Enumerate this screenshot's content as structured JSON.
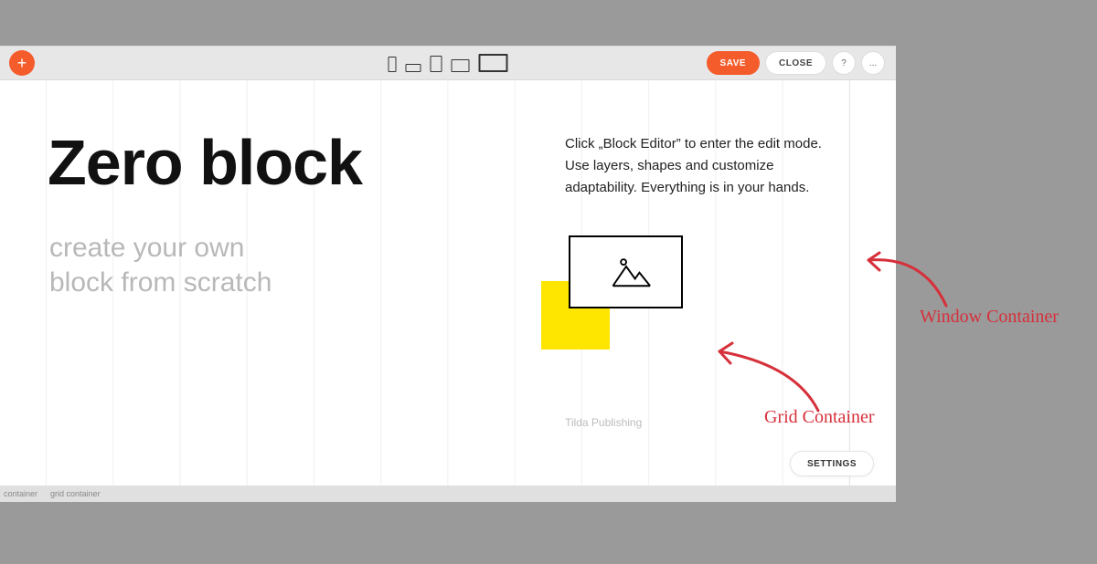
{
  "toolbar": {
    "add_icon": "+",
    "save_label": "SAVE",
    "close_label": "CLOSE",
    "help_icon": "?",
    "more_icon": "..."
  },
  "hero": {
    "title": "Zero block",
    "subtitle_line1": "create your own",
    "subtitle_line2": "block from scratch"
  },
  "description": "Click „Block Editor” to enter the edit mode. Use layers, shapes and customize adaptability. Everything is in your hands.",
  "credit": "Tilda Publishing",
  "settings_label": "SETTINGS",
  "status": {
    "container": "container",
    "grid_container": "grid container"
  },
  "annotations": {
    "window_container": "Window Container",
    "grid_container": "Grid Container"
  },
  "colors": {
    "accent": "#f45c2c",
    "annotation": "#d6303b",
    "highlight": "#ffe600"
  }
}
